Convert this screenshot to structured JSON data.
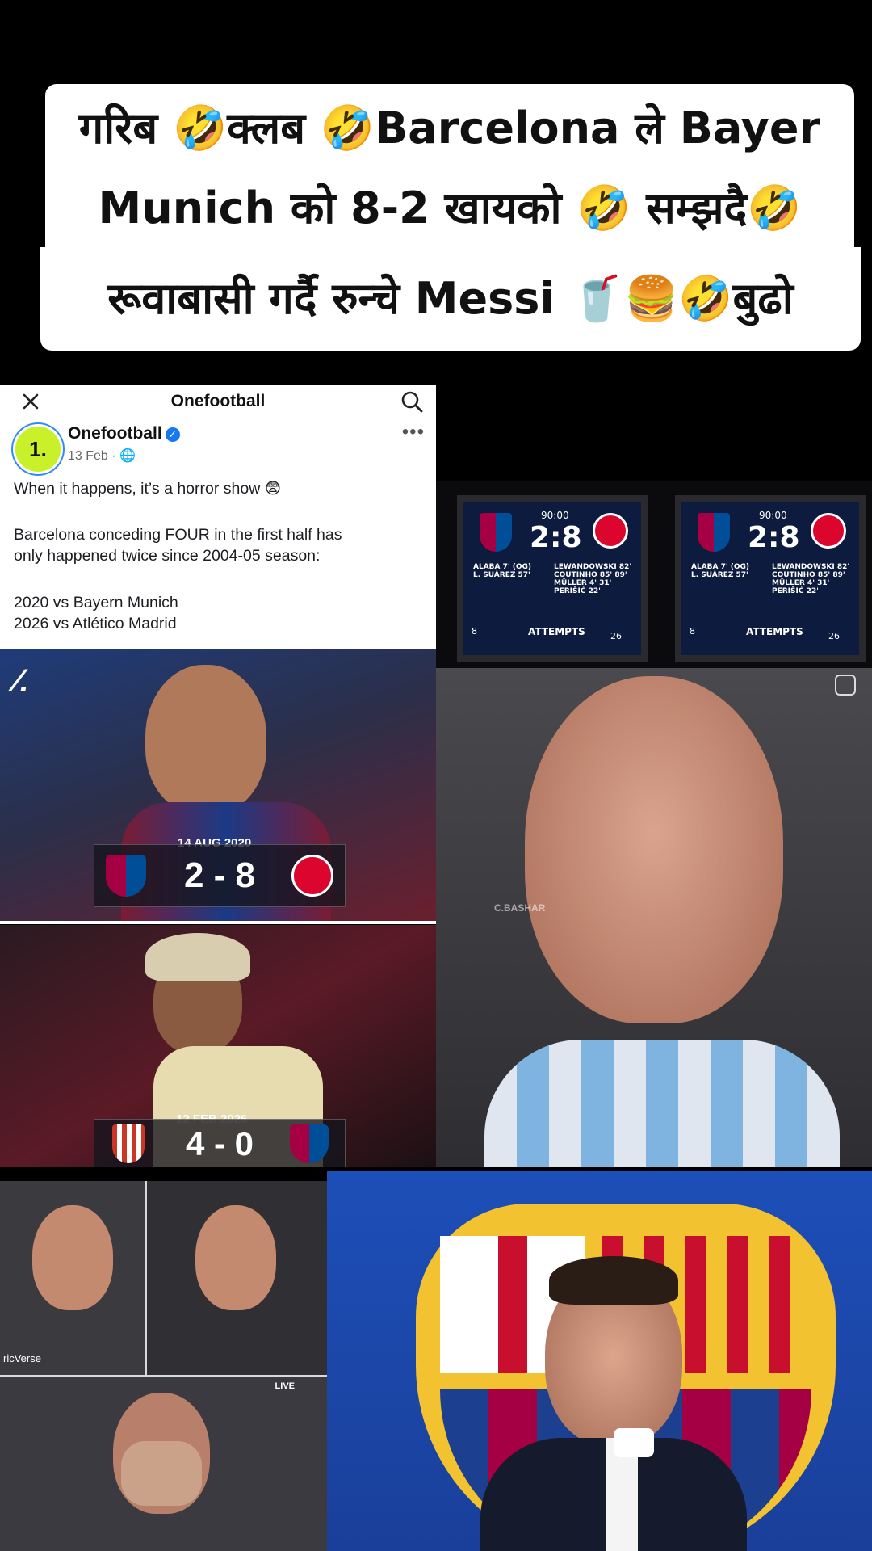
{
  "caption": {
    "line1": "गरिब 🤣क्लब 🤣Barcelona ले Bayer",
    "line2": "Munich को 8-2 खायको  🤣 सम्झदै🤣",
    "line3": "रूवाबासी गर्दै रुन्चे Messi 🥤🍔🤣बुढो"
  },
  "post": {
    "header_title": "Onefootball",
    "account_name": "Onefootball",
    "date": "13 Feb ·",
    "line1": "When it happens, it’s a horror show 😨",
    "line2": "Barcelona conceding FOUR in the first half has",
    "line3": "only happened twice since 2004-05 season:",
    "line4": "2020 vs Bayern Munich",
    "line5": "2026 vs Atlético Madrid",
    "logo_text": "1."
  },
  "match1": {
    "date": "14 AUG 2020",
    "score": "2 - 8"
  },
  "match2": {
    "date": "12 FEB 2026",
    "score": "4 - 0"
  },
  "screen": {
    "time": "90:00",
    "score": "2:8",
    "scorers_left": "ALABA 7' (OG)\nL. SUÁREZ 57'",
    "scorers_right": "LEWANDOWSKI 82'\nCOUTINHO 85' 89'\nMÜLLER 4' 31'\nPERIŠIĆ 22'",
    "attempts_label": "ATTEMPTS",
    "attempts_left": "8",
    "attempts_right": "26"
  },
  "watermarks": {
    "cbashar": "C.BASHAR",
    "ricverse": "ricVerse",
    "live": "LIVE"
  },
  "colors": {
    "barca_blue": "#1d4fb8",
    "onefootball_green": "#c8f12a"
  }
}
